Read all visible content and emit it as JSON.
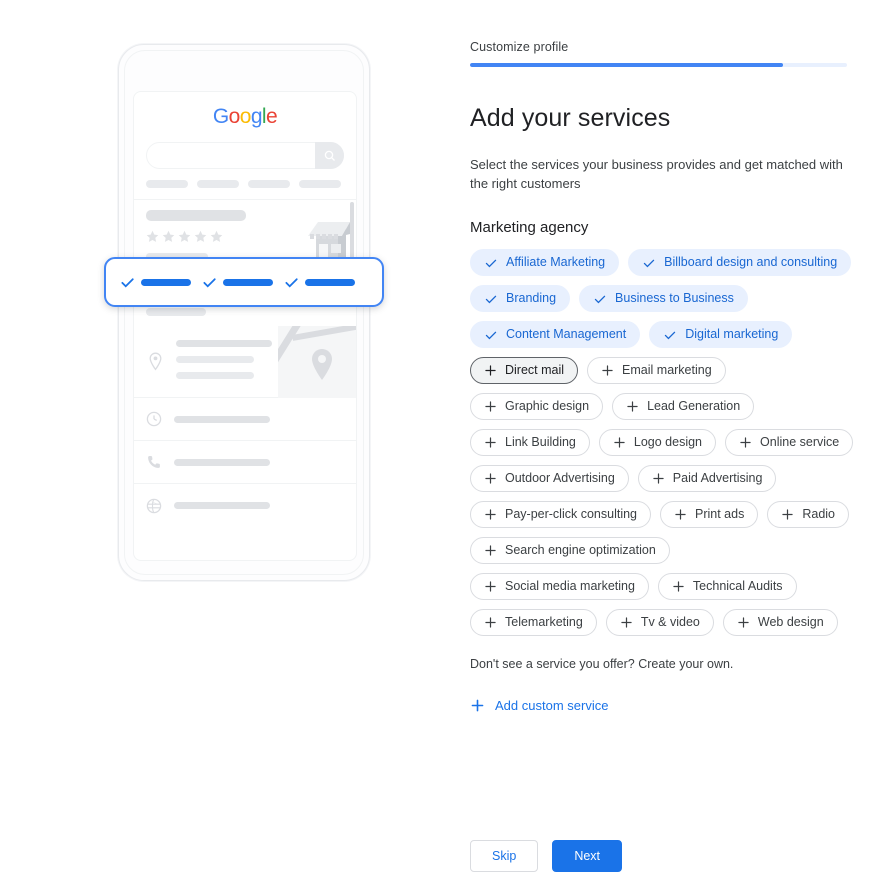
{
  "step": {
    "label": "Customize profile",
    "progress_percent": 83,
    "progress_color": "#4285f4",
    "progress_track_color": "#e8f0fe"
  },
  "main": {
    "title": "Add your services",
    "subtitle": "Select the services your business provides and get matched with the right customers",
    "category_label": "Marketing agency",
    "hint": "Don't see a service you offer? Create your own.",
    "add_custom_label": "Add custom service",
    "add_custom_icon": "plus-icon"
  },
  "chip_rows": [
    [
      {
        "label": "Affiliate Marketing",
        "state": "selected",
        "icon": "check-icon"
      },
      {
        "label": "Billboard design and consulting",
        "state": "selected",
        "icon": "check-icon"
      }
    ],
    [
      {
        "label": "Branding",
        "state": "selected",
        "icon": "check-icon"
      },
      {
        "label": "Business to Business",
        "state": "selected",
        "icon": "check-icon"
      }
    ],
    [
      {
        "label": "Content Management",
        "state": "selected",
        "icon": "check-icon"
      },
      {
        "label": "Digital marketing",
        "state": "selected",
        "icon": "check-icon"
      }
    ],
    [
      {
        "label": "Direct mail",
        "state": "hovered",
        "icon": "plus-icon"
      },
      {
        "label": "Email marketing",
        "state": "default",
        "icon": "plus-icon"
      }
    ],
    [
      {
        "label": "Graphic design",
        "state": "default",
        "icon": "plus-icon"
      },
      {
        "label": "Lead Generation",
        "state": "default",
        "icon": "plus-icon"
      }
    ],
    [
      {
        "label": "Link Building",
        "state": "default",
        "icon": "plus-icon"
      },
      {
        "label": "Logo design",
        "state": "default",
        "icon": "plus-icon"
      },
      {
        "label": "Online service",
        "state": "default",
        "icon": "plus-icon"
      }
    ],
    [
      {
        "label": "Outdoor Advertising",
        "state": "default",
        "icon": "plus-icon"
      },
      {
        "label": "Paid Advertising",
        "state": "default",
        "icon": "plus-icon"
      }
    ],
    [
      {
        "label": "Pay-per-click consulting",
        "state": "default",
        "icon": "plus-icon"
      },
      {
        "label": "Print ads",
        "state": "default",
        "icon": "plus-icon"
      },
      {
        "label": "Radio",
        "state": "default",
        "icon": "plus-icon"
      }
    ],
    [
      {
        "label": "Search engine optimization",
        "state": "default",
        "icon": "plus-icon"
      }
    ],
    [
      {
        "label": "Social media marketing",
        "state": "default",
        "icon": "plus-icon"
      },
      {
        "label": "Technical Audits",
        "state": "default",
        "icon": "plus-icon"
      }
    ],
    [
      {
        "label": "Telemarketing",
        "state": "default",
        "icon": "plus-icon"
      },
      {
        "label": "Tv & video",
        "state": "default",
        "icon": "plus-icon"
      },
      {
        "label": "Web design",
        "state": "default",
        "icon": "plus-icon"
      }
    ]
  ],
  "footer": {
    "skip_label": "Skip",
    "next_label": "Next",
    "next_color": "#1a73e8"
  },
  "illustration": {
    "google_logo": {
      "letters": [
        "G",
        "o",
        "o",
        "g",
        "l",
        "e"
      ]
    },
    "search_icon": "magnifier-icon",
    "highlight_card": {
      "items": [
        {
          "icon": "check-icon"
        },
        {
          "icon": "check-icon"
        }
      ],
      "accent_color": "#1a73e8",
      "border_color": "#4285f4"
    },
    "rows": [
      {
        "icon": "location-pin-icon"
      },
      {
        "icon": "clock-icon"
      },
      {
        "icon": "phone-icon"
      },
      {
        "icon": "globe-icon"
      }
    ],
    "star_count": 5,
    "storefront_icon": "storefront-icon",
    "chevron_icon": "chevron-right-icon"
  }
}
